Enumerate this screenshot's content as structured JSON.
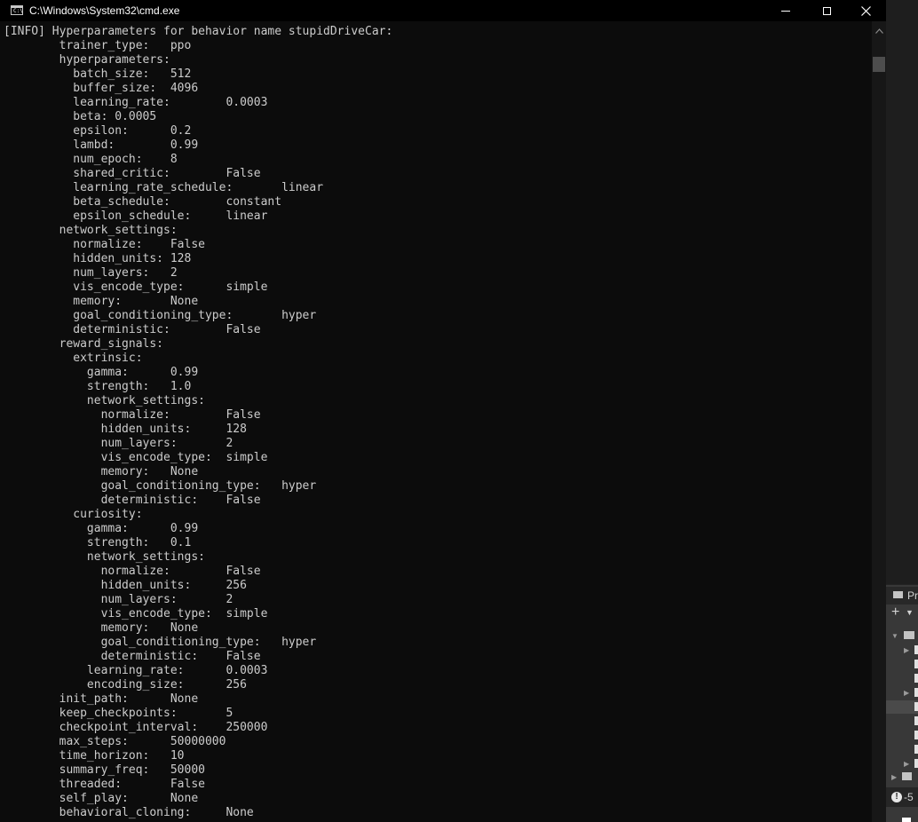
{
  "window": {
    "title": "C:\\Windows\\System32\\cmd.exe",
    "icon_label": "C:\\",
    "controls": [
      "minimize",
      "maximize",
      "close"
    ]
  },
  "console": {
    "lines": [
      "[INFO] Hyperparameters for behavior name stupidDriveCar:",
      "        trainer_type:   ppo",
      "        hyperparameters:",
      "          batch_size:   512",
      "          buffer_size:  4096",
      "          learning_rate:        0.0003",
      "          beta: 0.0005",
      "          epsilon:      0.2",
      "          lambd:        0.99",
      "          num_epoch:    8",
      "          shared_critic:        False",
      "          learning_rate_schedule:       linear",
      "          beta_schedule:        constant",
      "          epsilon_schedule:     linear",
      "        network_settings:",
      "          normalize:    False",
      "          hidden_units: 128",
      "          num_layers:   2",
      "          vis_encode_type:      simple",
      "          memory:       None",
      "          goal_conditioning_type:       hyper",
      "          deterministic:        False",
      "        reward_signals:",
      "          extrinsic:",
      "            gamma:      0.99",
      "            strength:   1.0",
      "            network_settings:",
      "              normalize:        False",
      "              hidden_units:     128",
      "              num_layers:       2",
      "              vis_encode_type:  simple",
      "              memory:   None",
      "              goal_conditioning_type:   hyper",
      "              deterministic:    False",
      "          curiosity:",
      "            gamma:      0.99",
      "            strength:   0.1",
      "            network_settings:",
      "              normalize:        False",
      "              hidden_units:     256",
      "              num_layers:       2",
      "              vis_encode_type:  simple",
      "              memory:   None",
      "              goal_conditioning_type:   hyper",
      "              deterministic:    False",
      "            learning_rate:      0.0003",
      "            encoding_size:      256",
      "        init_path:      None",
      "        keep_checkpoints:       5",
      "        checkpoint_interval:    250000",
      "        max_steps:      50000000",
      "        time_horizon:   10",
      "        summary_freq:   50000",
      "        threaded:       False",
      "        self_play:      None",
      "        behavioral_cloning:     None"
    ]
  },
  "background_window": {
    "header_label": "Pr",
    "add_label": "+",
    "status_label": "-5",
    "status_icon": "warning-icon"
  },
  "colors": {
    "console_bg": "#0c0c0c",
    "console_text": "#cccccc",
    "titlebar_bg": "#000000"
  }
}
